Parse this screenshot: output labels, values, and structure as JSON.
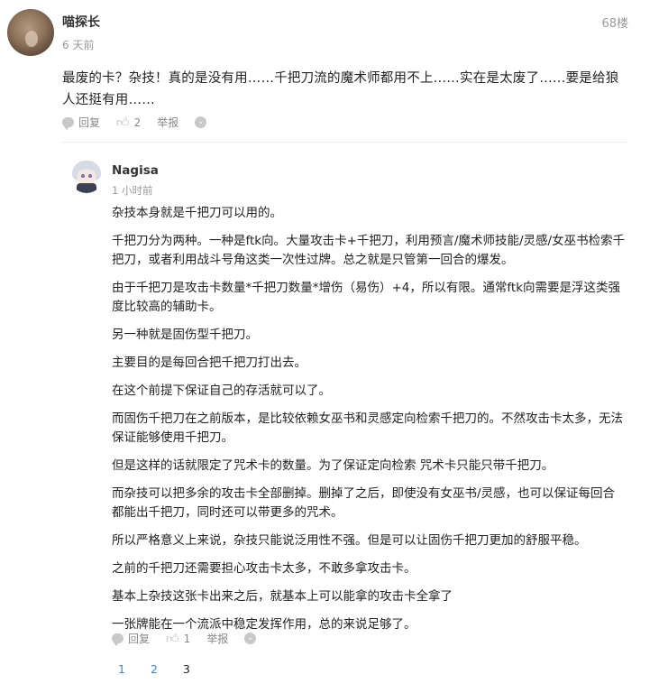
{
  "post": {
    "username": "喵探长",
    "time": "6 天前",
    "floor": "68楼",
    "content": "最废的卡？杂技！真的是没有用……千把刀流的魔术师都用不上……实在是太废了……要是给狼人还挺有用……",
    "actions": {
      "reply": "回复",
      "likes": "2",
      "report": "举报"
    }
  },
  "reply": {
    "username": "Nagisa",
    "time": "1 小时前",
    "paragraphs": [
      "杂技本身就是千把刀可以用的。",
      "千把刀分为两种。一种是ftk向。大量攻击卡+千把刀，利用预言/魔术师技能/灵感/女巫书检索千把刀，或者利用战斗号角这类一次性过牌。总之就是只管第一回合的爆发。",
      "由于千把刀是攻击卡数量*千把刀数量*增伤（易伤）+4，所以有限。通常ftk向需要是浮这类强度比较高的辅助卡。",
      "另一种就是固伤型千把刀。",
      "主要目的是每回合把千把刀打出去。",
      "在这个前提下保证自己的存活就可以了。",
      "而固伤千把刀在之前版本，是比较依赖女巫书和灵感定向检索千把刀的。不然攻击卡太多，无法保证能够使用千把刀。",
      "但是这样的话就限定了咒术卡的数量。为了保证定向检索 咒术卡只能只带千把刀。",
      "而杂技可以把多余的攻击卡全部删掉。删掉了之后，即使没有女巫书/灵感，也可以保证每回合都能出千把刀，同时还可以带更多的咒术。",
      "所以严格意义上来说，杂技只能说泛用性不强。但是可以让固伤千把刀更加的舒服平稳。",
      "之前的千把刀还需要担心攻击卡太多，不敢多拿攻击卡。",
      "基本上杂技这张卡出来之后，就基本上可以能拿的攻击卡全拿了",
      "一张牌能在一个流派中稳定发挥作用，总的来说足够了。"
    ],
    "actions": {
      "reply": "回复",
      "likes": "1",
      "report": "举报"
    }
  },
  "pagination": {
    "pages": [
      "1",
      "2",
      "3"
    ],
    "current": "3"
  }
}
